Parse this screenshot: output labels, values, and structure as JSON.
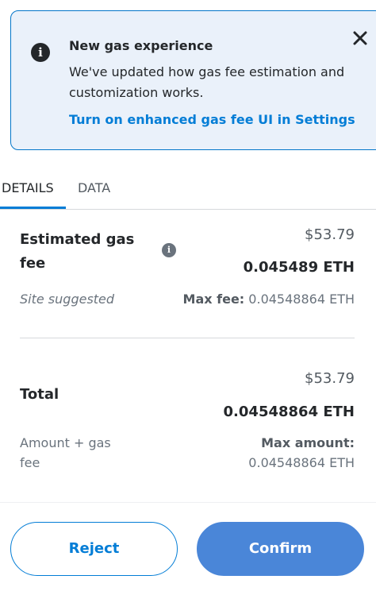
{
  "banner": {
    "title": "New gas experience",
    "body": "We've updated how gas fee estimation and customization works.",
    "link": "Turn on enhanced gas fee UI in Settings",
    "info_icon": "info-icon",
    "close_icon": "close-icon",
    "close_glyph": "✕"
  },
  "tabs": [
    {
      "label": "DETAILS",
      "active": true
    },
    {
      "label": "DATA",
      "active": false
    }
  ],
  "gas": {
    "label_line1": "Estimated gas",
    "label_line2": "fee",
    "subtitle": "Site suggested",
    "usd": "$53.79",
    "eth": "0.045489 ETH",
    "max_fee_label": "Max fee:",
    "max_fee_value": "0.04548864 ETH"
  },
  "total": {
    "label": "Total",
    "subtitle_line1": "Amount + gas",
    "subtitle_line2": "fee",
    "usd": "$53.79",
    "eth": "0.04548864 ETH",
    "max_amount_label": "Max amount:",
    "max_amount_value": "0.04548864 ETH"
  },
  "buttons": {
    "reject": "Reject",
    "confirm": "Confirm"
  },
  "colors": {
    "primary": "#037dd6",
    "confirm_bg": "#4a86d8",
    "banner_bg": "#eaf1fa"
  }
}
